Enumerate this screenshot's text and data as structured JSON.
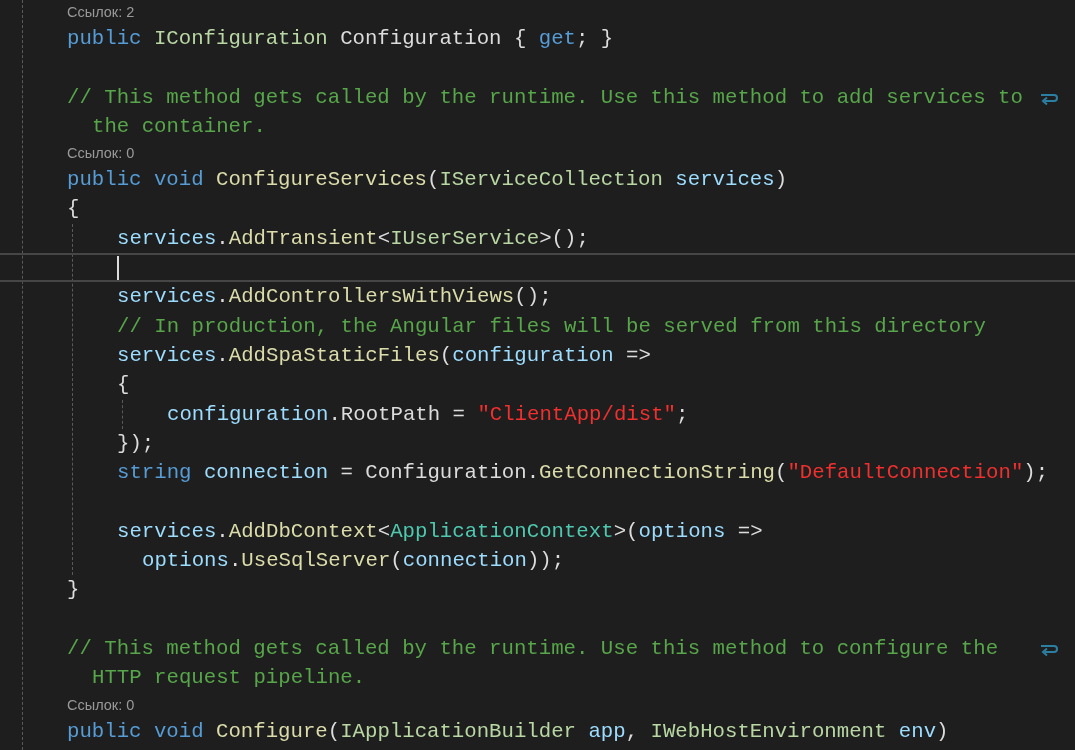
{
  "editor": {
    "lines": [
      {
        "kind": "codelens",
        "text": "Ссылок: 2"
      },
      {
        "kind": "code",
        "tokens": [
          {
            "text": "public ",
            "kind": "kw"
          },
          {
            "text": "IConfiguration ",
            "kind": "iface"
          },
          {
            "text": "Configuration { ",
            "kind": "plain"
          },
          {
            "text": "get",
            "kind": "kw"
          },
          {
            "text": "; }",
            "kind": "plain"
          }
        ]
      },
      {
        "kind": "blank"
      },
      {
        "kind": "comment-wrapped",
        "text": "// This method gets called by the runtime. Use this method to add services to",
        "continuation": "the container."
      },
      {
        "kind": "codelens",
        "text": "Ссылок: 0"
      },
      {
        "kind": "code",
        "tokens": [
          {
            "text": "public void ",
            "kind": "kw"
          },
          {
            "text": "ConfigureServices",
            "kind": "method"
          },
          {
            "text": "(",
            "kind": "plain"
          },
          {
            "text": "IServiceCollection ",
            "kind": "iface"
          },
          {
            "text": "services",
            "kind": "param"
          },
          {
            "text": ")",
            "kind": "plain"
          }
        ]
      },
      {
        "kind": "code",
        "tokens": [
          {
            "text": "{",
            "kind": "plain"
          }
        ],
        "children": [
          {
            "kind": "code",
            "tokens": [
              {
                "text": "services",
                "kind": "param"
              },
              {
                "text": ".",
                "kind": "plain"
              },
              {
                "text": "AddTransient",
                "kind": "method"
              },
              {
                "text": "<",
                "kind": "plain"
              },
              {
                "text": "IUserService",
                "kind": "iface"
              },
              {
                "text": ">();",
                "kind": "plain"
              }
            ]
          },
          {
            "kind": "cursor"
          },
          {
            "kind": "code",
            "tokens": [
              {
                "text": "services",
                "kind": "param"
              },
              {
                "text": ".",
                "kind": "plain"
              },
              {
                "text": "AddControllersWithViews",
                "kind": "method"
              },
              {
                "text": "();",
                "kind": "plain"
              }
            ]
          },
          {
            "kind": "code",
            "tokens": [
              {
                "text": "// In production, the Angular files will be served from this directory",
                "kind": "comment"
              }
            ]
          },
          {
            "kind": "code",
            "tokens": [
              {
                "text": "services",
                "kind": "param"
              },
              {
                "text": ".",
                "kind": "plain"
              },
              {
                "text": "AddSpaStaticFiles",
                "kind": "method"
              },
              {
                "text": "(",
                "kind": "plain"
              },
              {
                "text": "configuration",
                "kind": "param"
              },
              {
                "text": " =>",
                "kind": "plain"
              }
            ]
          },
          {
            "kind": "code",
            "tokens": [
              {
                "text": "{",
                "kind": "plain"
              }
            ],
            "children": [
              {
                "kind": "code",
                "tokens": [
                  {
                    "text": "configuration",
                    "kind": "param"
                  },
                  {
                    "text": ".RootPath = ",
                    "kind": "plain"
                  },
                  {
                    "text": "\"ClientApp/dist\"",
                    "kind": "str"
                  },
                  {
                    "text": ";",
                    "kind": "plain"
                  }
                ]
              }
            ]
          },
          {
            "kind": "code",
            "tokens": [
              {
                "text": "});",
                "kind": "plain"
              }
            ]
          },
          {
            "kind": "code",
            "tokens": [
              {
                "text": "string ",
                "kind": "kw"
              },
              {
                "text": "connection",
                "kind": "param"
              },
              {
                "text": " = Configuration.",
                "kind": "plain"
              },
              {
                "text": "GetConnectionString",
                "kind": "method"
              },
              {
                "text": "(",
                "kind": "plain"
              },
              {
                "text": "\"DefaultConnection\"",
                "kind": "str"
              },
              {
                "text": ");",
                "kind": "plain"
              }
            ]
          },
          {
            "kind": "blank"
          },
          {
            "kind": "code",
            "tokens": [
              {
                "text": "services",
                "kind": "param"
              },
              {
                "text": ".",
                "kind": "plain"
              },
              {
                "text": "AddDbContext",
                "kind": "method"
              },
              {
                "text": "<",
                "kind": "plain"
              },
              {
                "text": "ApplicationContext",
                "kind": "cls"
              },
              {
                "text": ">(",
                "kind": "plain"
              },
              {
                "text": "options",
                "kind": "param"
              },
              {
                "text": " =>",
                "kind": "plain"
              }
            ]
          },
          {
            "kind": "continued",
            "tokens": [
              {
                "text": "options",
                "kind": "param"
              },
              {
                "text": ".",
                "kind": "plain"
              },
              {
                "text": "UseSqlServer",
                "kind": "method"
              },
              {
                "text": "(",
                "kind": "plain"
              },
              {
                "text": "connection",
                "kind": "param"
              },
              {
                "text": "));",
                "kind": "plain"
              }
            ]
          }
        ]
      },
      {
        "kind": "code",
        "tokens": [
          {
            "text": "}",
            "kind": "plain"
          }
        ]
      },
      {
        "kind": "blank"
      },
      {
        "kind": "comment-wrapped",
        "text": "// This method gets called by the runtime. Use this method to configure the",
        "continuation": "HTTP request pipeline."
      },
      {
        "kind": "codelens",
        "text": "Ссылок: 0"
      },
      {
        "kind": "code",
        "tokens": [
          {
            "text": "public void ",
            "kind": "kw"
          },
          {
            "text": "Configure",
            "kind": "method"
          },
          {
            "text": "(",
            "kind": "plain"
          },
          {
            "text": "IApplicationBuilder ",
            "kind": "iface"
          },
          {
            "text": "app",
            "kind": "param"
          },
          {
            "text": ", ",
            "kind": "plain"
          },
          {
            "text": "IWebHostEnvironment ",
            "kind": "iface"
          },
          {
            "text": "env",
            "kind": "param"
          },
          {
            "text": ")",
            "kind": "plain"
          }
        ]
      }
    ]
  }
}
